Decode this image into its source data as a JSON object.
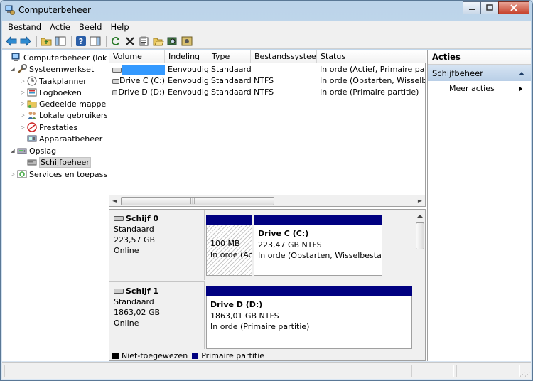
{
  "window": {
    "title": "Computerbeheer",
    "buttons": {
      "minimize": "—",
      "maximize": "☐",
      "close": "✕"
    }
  },
  "menu": [
    {
      "label": "Bestand",
      "accel": "B",
      "rest": "estand"
    },
    {
      "label": "Actie",
      "accel": "A",
      "rest": "ctie"
    },
    {
      "label": "Beeld",
      "accel": "e",
      "pre": "B",
      "rest": "eld"
    },
    {
      "label": "Help",
      "accel": "H",
      "rest": "elp"
    }
  ],
  "toolbar": {
    "icons": [
      "back-arrow-icon",
      "forward-arrow-icon",
      "up-folder-icon",
      "show-hide-tree-icon",
      "help-icon",
      "show-hide-action-icon",
      "refresh-icon",
      "delete-icon",
      "properties-icon",
      "open-icon",
      "search-icon",
      "settings-icon"
    ]
  },
  "tree": {
    "root": "Computerbeheer (lokaal)",
    "system_tools": "Systeemwerkset",
    "task_scheduler": "Taakplanner",
    "event_viewer": "Logboeken",
    "shared_folders": "Gedeelde mappen",
    "local_users": "Lokale gebruikers en groepen",
    "performance": "Prestaties",
    "device_manager": "Apparaatbeheer",
    "storage": "Opslag",
    "disk_management": "Schijfbeheer",
    "services": "Services en toepassingen"
  },
  "volume_list": {
    "columns": [
      "Volume",
      "Indeling",
      "Type",
      "Bestandssysteem",
      "Status"
    ],
    "rows": [
      {
        "volume": "",
        "layout": "Eenvoudig",
        "type": "Standaard",
        "fs": "",
        "status": "In orde (Actief, Primaire partitie)"
      },
      {
        "volume": "Drive C (C:)",
        "layout": "Eenvoudig",
        "type": "Standaard",
        "fs": "NTFS",
        "status": "In orde (Opstarten, Wisselbestand"
      },
      {
        "volume": "Drive D (D:)",
        "layout": "Eenvoudig",
        "type": "Standaard",
        "fs": "NTFS",
        "status": "In orde (Primaire partitie)"
      }
    ],
    "scroll": {
      "left": "◄",
      "right": "►",
      "grip": "|||"
    }
  },
  "disks": [
    {
      "name": "Schijf 0",
      "type": "Standaard",
      "size": "223,57 GB",
      "state": "Online",
      "partitions": [
        {
          "title": "",
          "size": "100 MB",
          "status": "In orde (Actief, Primaire partitie)"
        },
        {
          "title": "Drive C  (C:)",
          "size": "223,47 GB NTFS",
          "status": "In orde (Opstarten, Wisselbestand, Crashdump, Primaire partitie)"
        }
      ]
    },
    {
      "name": "Schijf 1",
      "type": "Standaard",
      "size": "1863,02 GB",
      "state": "Online",
      "partitions": [
        {
          "title": "Drive D  (D:)",
          "size": "1863,01 GB NTFS",
          "status": "In orde (Primaire partitie)"
        }
      ]
    }
  ],
  "legend": {
    "unallocated": "Niet-toegewezen",
    "primary": "Primaire partitie"
  },
  "actions": {
    "title": "Acties",
    "group": "Schijfbeheer",
    "more": "Meer acties"
  },
  "colors": {
    "primary_partition": "#000080",
    "unallocated": "#000000",
    "selection": "#3399ff"
  }
}
